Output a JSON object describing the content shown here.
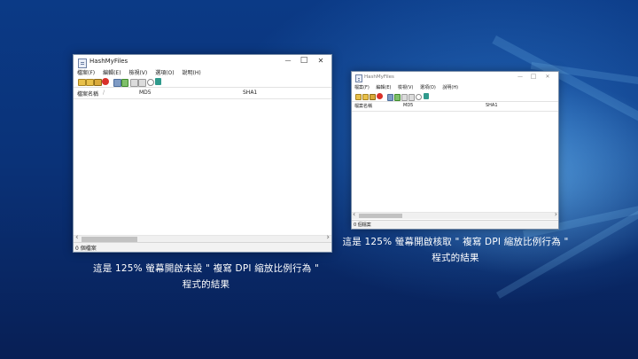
{
  "window_title": "HashMyFiles",
  "menu": [
    "檔案(F)",
    "編輯(E)",
    "檢視(V)",
    "選項(O)",
    "說明(H)"
  ],
  "columns": [
    "檔案名稱",
    "MD5",
    "SHA1"
  ],
  "sort_indicator": "/",
  "status_text": "0 個檔案",
  "controls": {
    "minimize": "—",
    "maximize": "□",
    "close": "✕"
  },
  "scroll_arrows": {
    "left": "‹",
    "right": "›"
  },
  "toolbar_icons": [
    "open-folder-icon",
    "open-folder-icon",
    "folder-icon",
    "delete-icon",
    "save-icon",
    "report-icon",
    "copy-icon",
    "copy-icon",
    "search-icon",
    "exit-icon"
  ],
  "captions": {
    "left_line1": "這是 125% 螢幕開啟未設 \" 複寫 DPI 縮放比例行為 \"",
    "left_line2": "程式的結果",
    "right_line1": "這是 125% 螢幕開啟核取 \" 複寫 DPI 縮放比例行為 \"",
    "right_line2": "程式的結果"
  }
}
